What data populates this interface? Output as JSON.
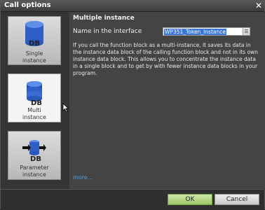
{
  "window": {
    "title": "Call options",
    "close_symbol": "✕"
  },
  "options": [
    {
      "label_line1": "Single",
      "label_line2": "instance",
      "icon": "db-single-icon",
      "selected": false
    },
    {
      "label_line1": "Multi",
      "label_line2": "instance",
      "icon": "db-multi-icon",
      "selected": true
    },
    {
      "label_line1": "Parameter",
      "label_line2": "instance",
      "icon": "db-parameter-icon",
      "selected": false
    }
  ],
  "content": {
    "heading": "Multiple instance",
    "name_label": "Name in the interface",
    "name_value": "WP351_Token_Instance",
    "name_field_button": "☰",
    "description": "If you call the function block as a multi-instance, it saves its data in the instance data block of the calling function block and not in its own instance data block. This allows you to concentrate the instance data in a single block and to get by with fewer instance data blocks in your program.",
    "more_link": "more..."
  },
  "buttons": {
    "ok": "OK",
    "cancel": "Cancel"
  },
  "icon_text": "DB",
  "colors": {
    "accent_blue": "#3875d7",
    "ok_green": "#9cc66a",
    "link": "#4aa0e6"
  }
}
